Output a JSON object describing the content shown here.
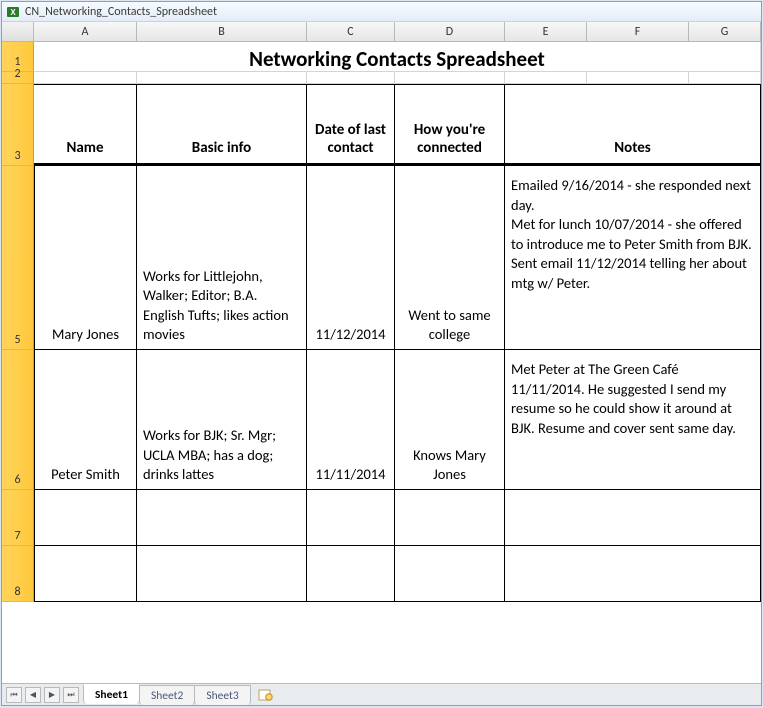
{
  "window": {
    "title": "CN_Networking_Contacts_Spreadsheet"
  },
  "columns": [
    "A",
    "B",
    "C",
    "D",
    "E",
    "F",
    "G"
  ],
  "row_numbers": [
    "1",
    "2",
    "3",
    "5",
    "6",
    "7",
    "8"
  ],
  "title_cell": "Networking Contacts Spreadsheet",
  "headers": {
    "name": "Name",
    "basic_info": "Basic info",
    "date": "Date of last contact",
    "connected": "How you're connected",
    "notes": "Notes"
  },
  "rows": [
    {
      "name": "Mary Jones",
      "basic_info": "Works for Littlejohn, Walker; Editor; B.A. English Tufts; likes action movies",
      "date": "11/12/2014",
      "connected": "Went to same college",
      "notes": "Emailed 9/16/2014 - she responded next day.\nMet for lunch 10/07/2014 - she offered to introduce me to Peter Smith from BJK.\nSent email 11/12/2014 telling her about mtg w/ Peter."
    },
    {
      "name": "Peter Smith",
      "basic_info": "Works for BJK; Sr. Mgr; UCLA MBA; has a dog; drinks lattes",
      "date": "11/11/2014",
      "connected": "Knows Mary Jones",
      "notes": "Met Peter at The Green Café 11/11/2014. He suggested I send my resume so he could show it around at BJK. Resume and cover sent same day."
    }
  ],
  "sheets": {
    "active": "Sheet1",
    "tabs": [
      "Sheet1",
      "Sheet2",
      "Sheet3"
    ]
  },
  "nav_icons": [
    "⏮",
    "◀",
    "▶",
    "⏭"
  ]
}
